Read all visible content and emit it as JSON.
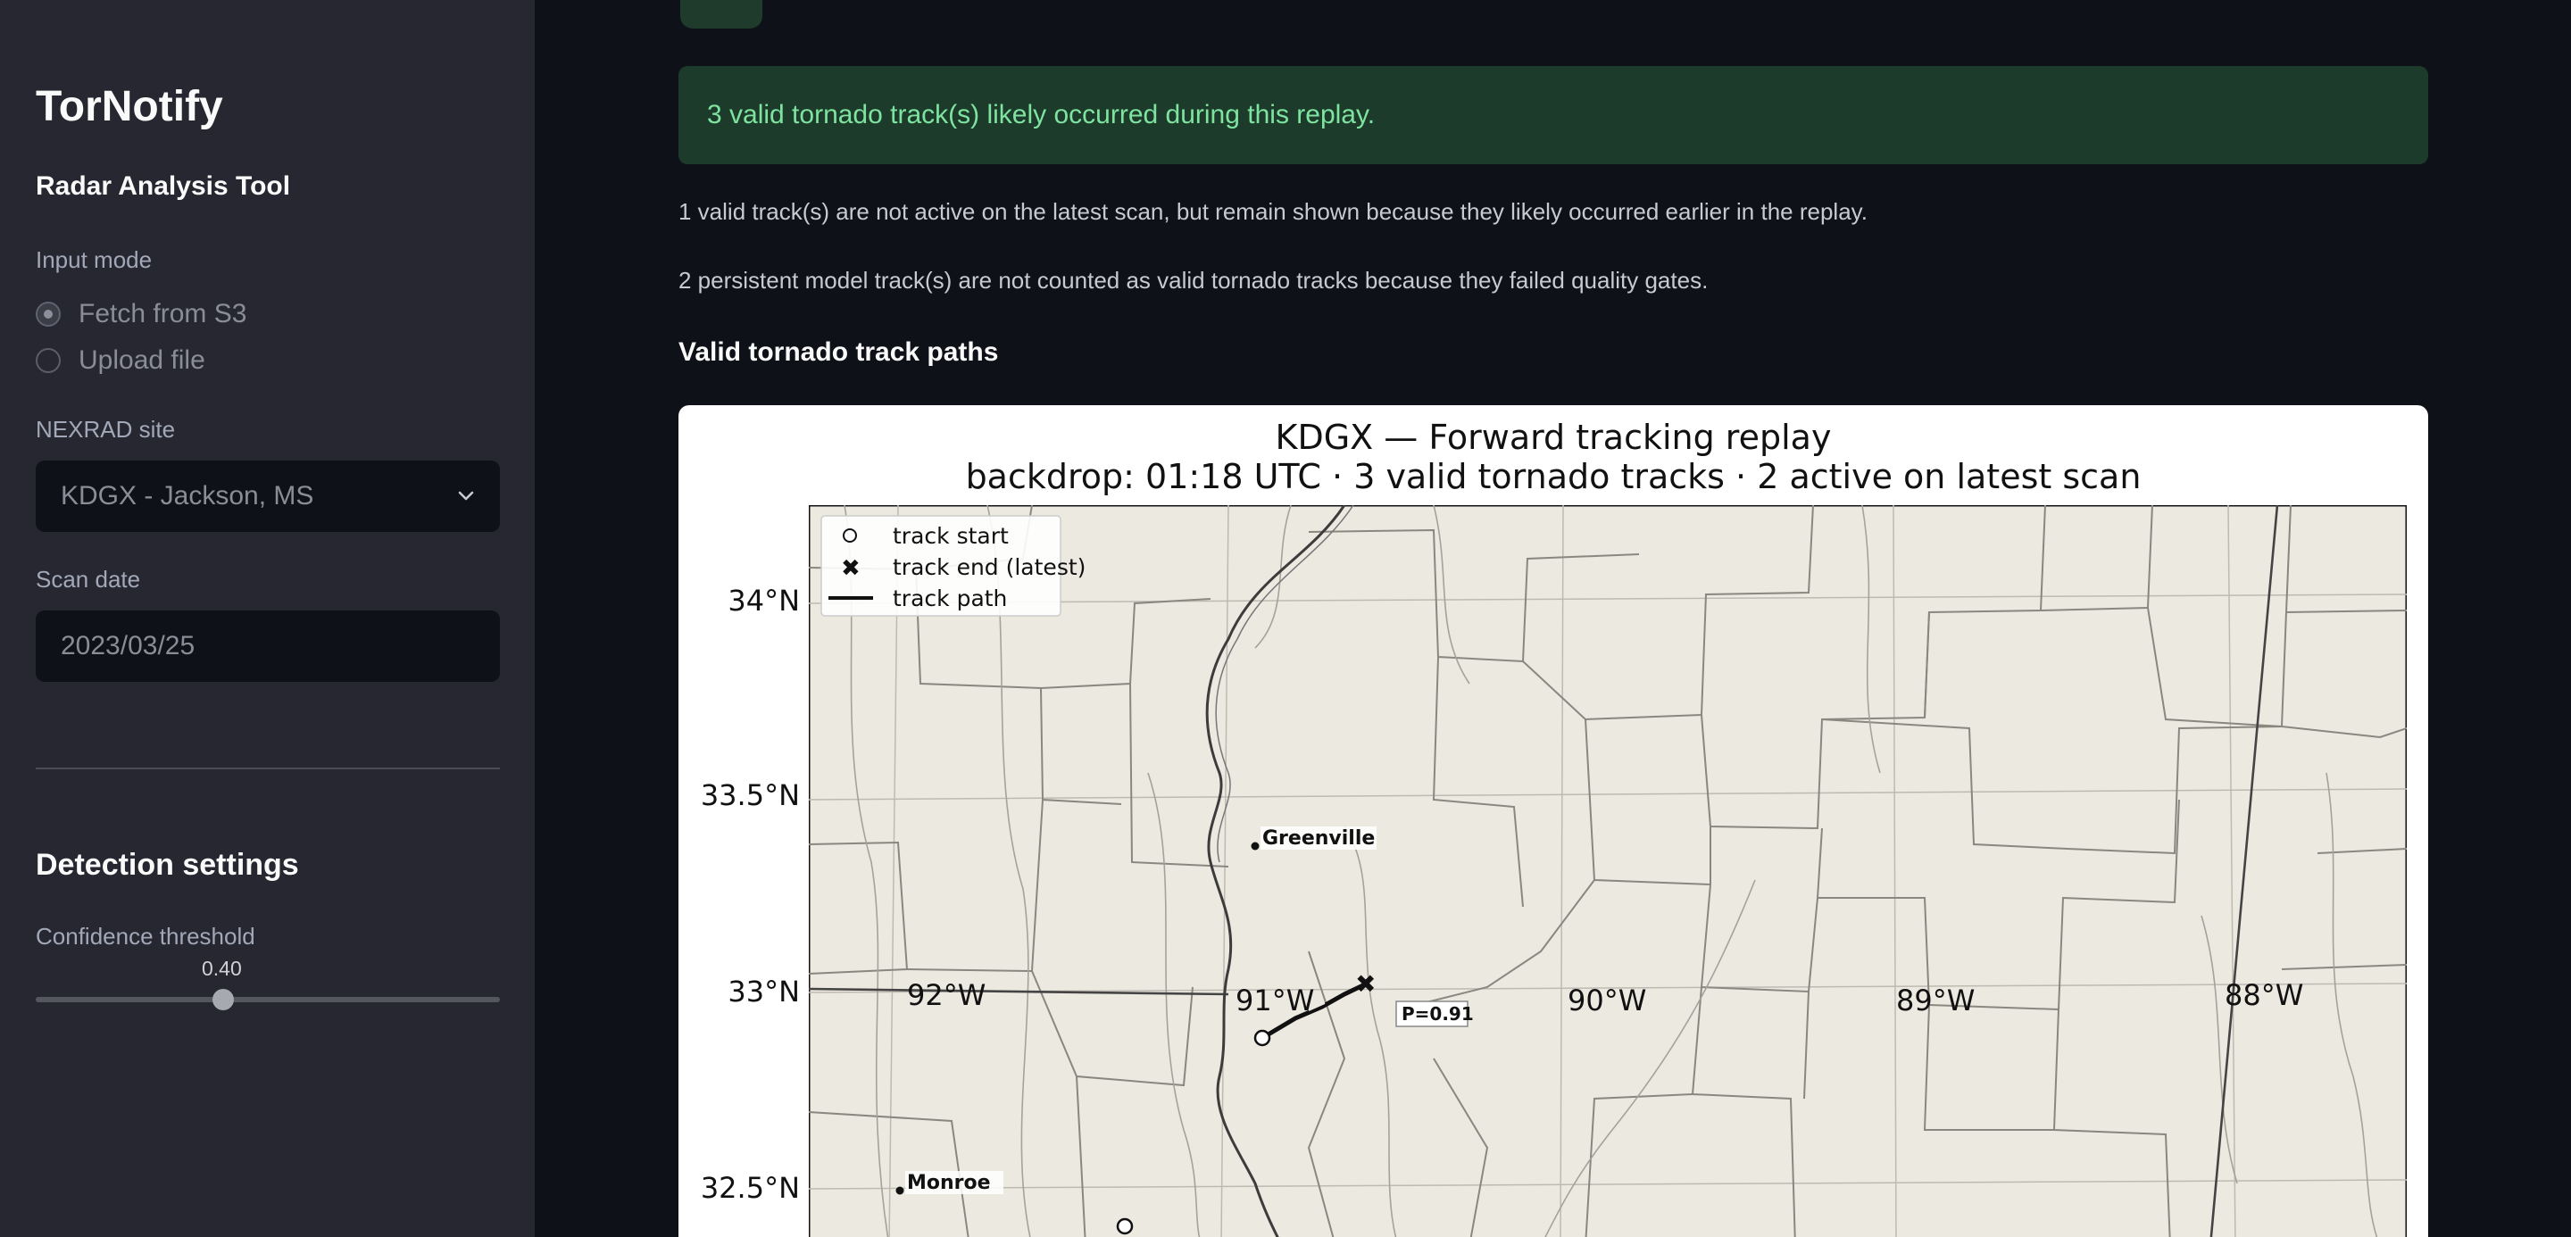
{
  "sidebar": {
    "app_title": "TorNotify",
    "subtitle": "Radar Analysis Tool",
    "input_mode": {
      "label": "Input mode",
      "options": [
        "Fetch from S3",
        "Upload file"
      ],
      "selected": "Fetch from S3"
    },
    "nexrad_site": {
      "label": "NEXRAD site",
      "value": "KDGX - Jackson, MS"
    },
    "scan_date": {
      "label": "Scan date",
      "value": "2023/03/25"
    },
    "detection_settings": {
      "heading": "Detection settings",
      "confidence_label": "Confidence threshold",
      "confidence_value": "0.40"
    }
  },
  "main": {
    "alert": "3 valid tornado track(s) likely occurred during this replay.",
    "info1": "1 valid track(s) are not active on the latest scan, but remain shown because they likely occurred earlier in the replay.",
    "info2": "2 persistent model track(s) are not counted as valid tornado tracks because they failed quality gates.",
    "section_title": "Valid tornado track paths"
  },
  "figure": {
    "title_line1": "KDGX — Forward tracking replay",
    "title_line2": "backdrop: 01:18 UTC · 3 valid tornado tracks · 2 active on latest scan",
    "legend": [
      "track start",
      "track end (latest)",
      "track path"
    ],
    "lat_labels": [
      "34°N",
      "33.5°N",
      "33°N",
      "32.5°N"
    ],
    "lon_labels": [
      "92°W",
      "91°W",
      "90°W",
      "89°W",
      "88°W"
    ],
    "cities": [
      "Greenville",
      "Monroe"
    ],
    "track_label": "P=0.91"
  },
  "colors": {
    "sidebar_bg": "#262730",
    "main_bg": "#0e1117",
    "alert_bg": "#1c3b2a",
    "alert_text": "#7fe3a0",
    "map_bg": "#ece9e1"
  }
}
